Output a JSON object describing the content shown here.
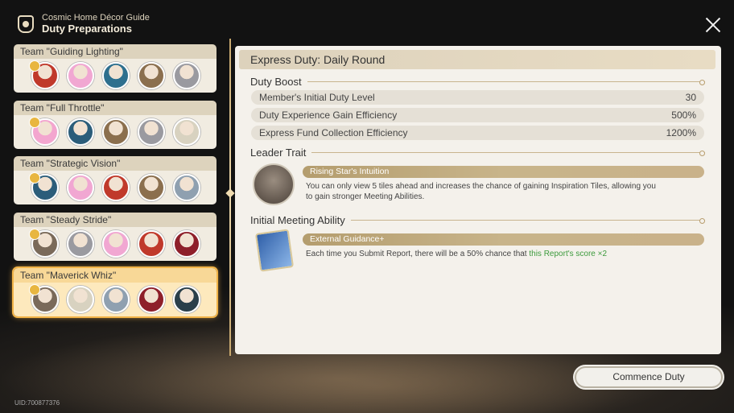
{
  "header": {
    "subtitle": "Cosmic Home Décor Guide",
    "title": "Duty Preparations"
  },
  "teams": [
    {
      "name": "Team \"Guiding Lighting\"",
      "selected": false,
      "avatars": [
        "#c0392b",
        "#f1a7d2",
        "#2e6f8e",
        "#8b6f4e",
        "#9a9aa0"
      ]
    },
    {
      "name": "Team \"Full Throttle\"",
      "selected": false,
      "avatars": [
        "#f3a6cf",
        "#2b5d7a",
        "#8b6f4e",
        "#9a9aa0",
        "#d8d2c0"
      ]
    },
    {
      "name": "Team \"Strategic Vision\"",
      "selected": false,
      "avatars": [
        "#2b5d7a",
        "#f1a7d2",
        "#c0392b",
        "#8b6f4e",
        "#8fa0b0"
      ]
    },
    {
      "name": "Team \"Steady Stride\"",
      "selected": false,
      "avatars": [
        "#7a6a5a",
        "#9a9aa0",
        "#f1a7d2",
        "#c0392b",
        "#8e1f2a"
      ]
    },
    {
      "name": "Team \"Maverick Whiz\"",
      "selected": true,
      "avatars": [
        "#7a6a5a",
        "#d8d2c0",
        "#8fa0b0",
        "#8e1f2a",
        "#2a3f4a"
      ]
    }
  ],
  "panel": {
    "title": "Express Duty: Daily Round",
    "duty_boost": {
      "heading": "Duty Boost",
      "stats": [
        {
          "label": "Member's Initial Duty Level",
          "value": "30"
        },
        {
          "label": "Duty Experience Gain Efficiency",
          "value": "500%"
        },
        {
          "label": "Express Fund Collection Efficiency",
          "value": "1200%"
        }
      ]
    },
    "leader_trait": {
      "heading": "Leader Trait",
      "name": "Rising Star's Intuition",
      "desc_line1": "You can only view 5 tiles ahead and increases the chance of gaining Inspiration Tiles, allowing you",
      "desc_line2": "to gain stronger Meeting Abilities."
    },
    "meeting_ability": {
      "heading": "Initial Meeting Ability",
      "name": "External Guidance+",
      "desc": "Each time you Submit Report, there will be a 50% chance that ",
      "desc_highlight": "this Report's score ×2"
    }
  },
  "commence_label": "Commence Duty",
  "uid": "UID:700877376",
  "colors": {
    "accent": "#f2b448",
    "highlight": "#3c9a3c",
    "bar": "#b49d6e"
  }
}
